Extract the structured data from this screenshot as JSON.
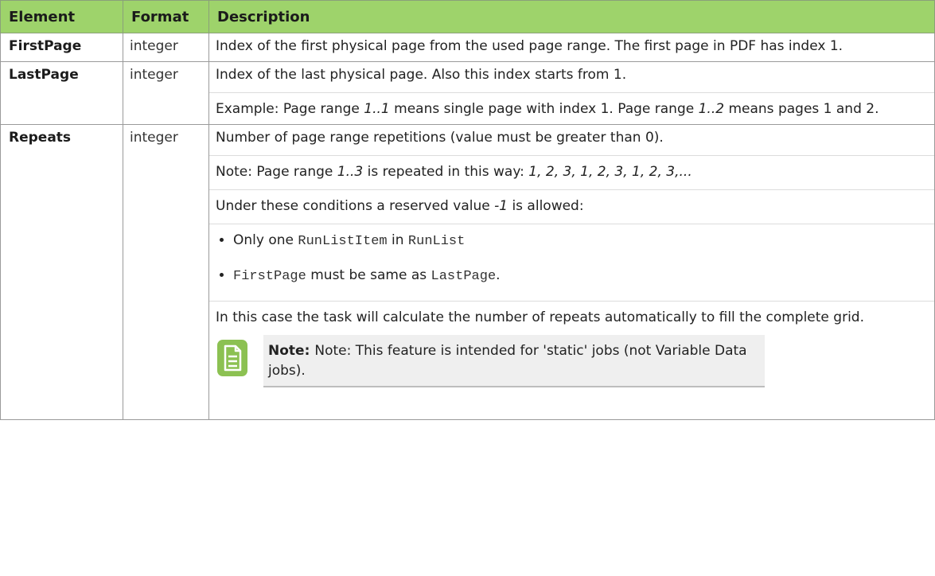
{
  "headers": {
    "element": "Element",
    "format": "Format",
    "description": "Description"
  },
  "rows": {
    "first": {
      "element": "FirstPage",
      "format": "integer",
      "desc": "Index of the first physical page from the used page range. The first page in PDF has index 1."
    },
    "last": {
      "element": "LastPage",
      "format": "integer",
      "desc1": "Index of the last physical page. Also this index starts from 1.",
      "ex_a": "Example: Page range ",
      "ex_r1": "1..1",
      "ex_b": " means single page with index 1. Page range ",
      "ex_r2": "1..2",
      "ex_c": " means pages 1 and 2."
    },
    "repeats": {
      "element": "Repeats",
      "format": "integer",
      "desc1": "Number of page range repetitions (value must be greater than 0).",
      "note_a": "Note: Page range ",
      "note_r": "1..3",
      "note_b": " is repeated in this way: ",
      "note_seq": "1, 2, 3, 1, 2, 3, 1, 2, 3,...",
      "cond_a": "Under these conditions a reserved value ",
      "cond_v": "-1",
      "cond_b": " is allowed:",
      "b1_a": "Only one ",
      "b1_code1": "RunListItem",
      "b1_mid": " in ",
      "b1_code2": "RunList",
      "b2_code1": "FirstPage",
      "b2_mid": " must be same as ",
      "b2_code2": "LastPage",
      "b2_end": ".",
      "auto": "In this case the task will calculate the number of repeats automatically to fill the complete grid.",
      "callout_label": "Note:",
      "callout_text": "Note: This feature is intended for 'static' jobs (not Variable Data jobs)."
    }
  },
  "colors": {
    "header_bg": "#9ed36b",
    "icon_green": "#8cc152"
  },
  "icons": {
    "note": "note-document-icon"
  }
}
